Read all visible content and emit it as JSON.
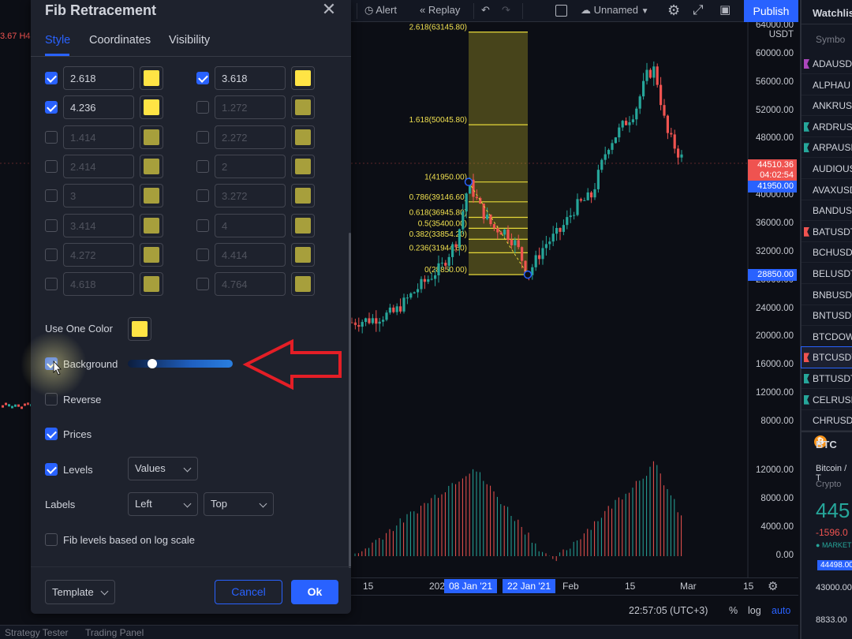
{
  "dialog": {
    "title": "Fib Retracement",
    "tabs": [
      {
        "label": "Style",
        "active": true
      },
      {
        "label": "Coordinates",
        "active": false
      },
      {
        "label": "Visibility",
        "active": false
      }
    ],
    "levels": [
      {
        "left": {
          "value": "2.618",
          "enabled": true,
          "color": "#ffe445"
        },
        "right": {
          "value": "3.618",
          "enabled": true,
          "color": "#ffe445"
        }
      },
      {
        "left": {
          "value": "4.236",
          "enabled": true,
          "color": "#ffe445"
        },
        "right": {
          "value": "1.272",
          "enabled": false,
          "color": "#a79f3c"
        }
      },
      {
        "left": {
          "value": "1.414",
          "enabled": false,
          "color": "#a79f3c"
        },
        "right": {
          "value": "2.272",
          "enabled": false,
          "color": "#a79f3c"
        }
      },
      {
        "left": {
          "value": "2.414",
          "enabled": false,
          "color": "#a79f3c"
        },
        "right": {
          "value": "2",
          "enabled": false,
          "color": "#a79f3c"
        }
      },
      {
        "left": {
          "value": "3",
          "enabled": false,
          "color": "#a79f3c"
        },
        "right": {
          "value": "3.272",
          "enabled": false,
          "color": "#a79f3c"
        }
      },
      {
        "left": {
          "value": "3.414",
          "enabled": false,
          "color": "#a79f3c"
        },
        "right": {
          "value": "4",
          "enabled": false,
          "color": "#a79f3c"
        }
      },
      {
        "left": {
          "value": "4.272",
          "enabled": false,
          "color": "#a79f3c"
        },
        "right": {
          "value": "4.414",
          "enabled": false,
          "color": "#a79f3c"
        }
      },
      {
        "left": {
          "value": "4.618",
          "enabled": false,
          "color": "#a79f3c"
        },
        "right": {
          "value": "4.764",
          "enabled": false,
          "color": "#a79f3c"
        }
      }
    ],
    "use_one_color": {
      "label": "Use One Color",
      "color": "#ffe445"
    },
    "background": {
      "label": "Background",
      "checked": true,
      "opacity": 0.2
    },
    "reverse": {
      "label": "Reverse",
      "checked": false
    },
    "prices": {
      "label": "Prices",
      "checked": true
    },
    "levels_opt": {
      "label": "Levels",
      "checked": true,
      "value": "Values"
    },
    "labels_opt": {
      "label": "Labels",
      "horizontal": "Left",
      "vertical": "Top"
    },
    "log_scale": {
      "label": "Fib levels based on log scale",
      "checked": false
    },
    "template_label": "Template",
    "cancel_label": "Cancel",
    "ok_label": "Ok"
  },
  "toolbar": {
    "alert_label": "Alert",
    "replay_label": "Replay",
    "layout_name": "Unnamed",
    "publish_label": "Publish"
  },
  "left_strip_text": "3.67 H4",
  "chart": {
    "currency": "USDT",
    "price_ticks": [
      "64000.00",
      "60000.00",
      "56000.00",
      "52000.00",
      "48000.00",
      "40000.00",
      "36000.00",
      "32000.00",
      "28000.00",
      "24000.00",
      "20000.00",
      "16000.00",
      "12000.00",
      "8000.00"
    ],
    "volume_ticks": [
      "12000.00",
      "8000.00",
      "4000.00",
      "0.00"
    ],
    "price_tags": [
      {
        "text": "44510.36",
        "sub": "04:02:54",
        "color": "#ef5350"
      },
      {
        "text": "41950.00",
        "color": "#2962ff"
      },
      {
        "text": "28850.00",
        "color": "#2962ff"
      }
    ],
    "fib_labels": [
      "2.618(63145.80)",
      "1.618(50045.80)",
      "1(41950.00)",
      "0.786(39146.60)",
      "0.618(36945.80)",
      "0.5(35400.00)",
      "0.382(33854.20)",
      "0.236(31944.60)",
      "0(28850.00)"
    ],
    "time_labels": [
      "15",
      "202",
      "Feb",
      "15",
      "Mar",
      "15"
    ],
    "time_tags": [
      "08 Jan '21",
      "22 Jan '21"
    ],
    "clock": "22:57:05 (UTC+3)",
    "scale_labels": [
      "%",
      "log",
      "auto"
    ]
  },
  "bottom_tabs": [
    "Strategy Tester",
    "Trading Panel"
  ],
  "watchlist": {
    "title": "Watchlis",
    "header": "Symbo",
    "items": [
      {
        "symbol": "ADAUSD",
        "flag": "#ab47bc"
      },
      {
        "symbol": "ALPHAU",
        "flag": ""
      },
      {
        "symbol": "ANKRUSD",
        "flag": ""
      },
      {
        "symbol": "ARDRUSD",
        "flag": "#26a69a"
      },
      {
        "symbol": "ARPAUSD",
        "flag": "#26a69a"
      },
      {
        "symbol": "AUDIOUS",
        "flag": ""
      },
      {
        "symbol": "AVAXUSD",
        "flag": ""
      },
      {
        "symbol": "BANDUSD",
        "flag": ""
      },
      {
        "symbol": "BATUSDT",
        "flag": "#ef5350"
      },
      {
        "symbol": "BCHUSDT",
        "flag": ""
      },
      {
        "symbol": "BELUSDT",
        "flag": ""
      },
      {
        "symbol": "BNBUSDT",
        "flag": ""
      },
      {
        "symbol": "BNTUSDT",
        "flag": ""
      },
      {
        "symbol": "BTCDOW",
        "flag": ""
      },
      {
        "symbol": "BTCUSDT",
        "flag": "#ef5350"
      },
      {
        "symbol": "BTTUSDT",
        "flag": "#26a69a"
      },
      {
        "symbol": "CELRUSD",
        "flag": "#26a69a"
      },
      {
        "symbol": "CHRUSDT",
        "flag": ""
      }
    ],
    "detail": {
      "name": "BTC",
      "full_name": "Bitcoin / T",
      "category": "Crypto",
      "price": "445",
      "change": "-1596.0",
      "market": "MARKET",
      "tag1": "44498.00",
      "low": "43000.00",
      "high": "8833.00"
    }
  }
}
